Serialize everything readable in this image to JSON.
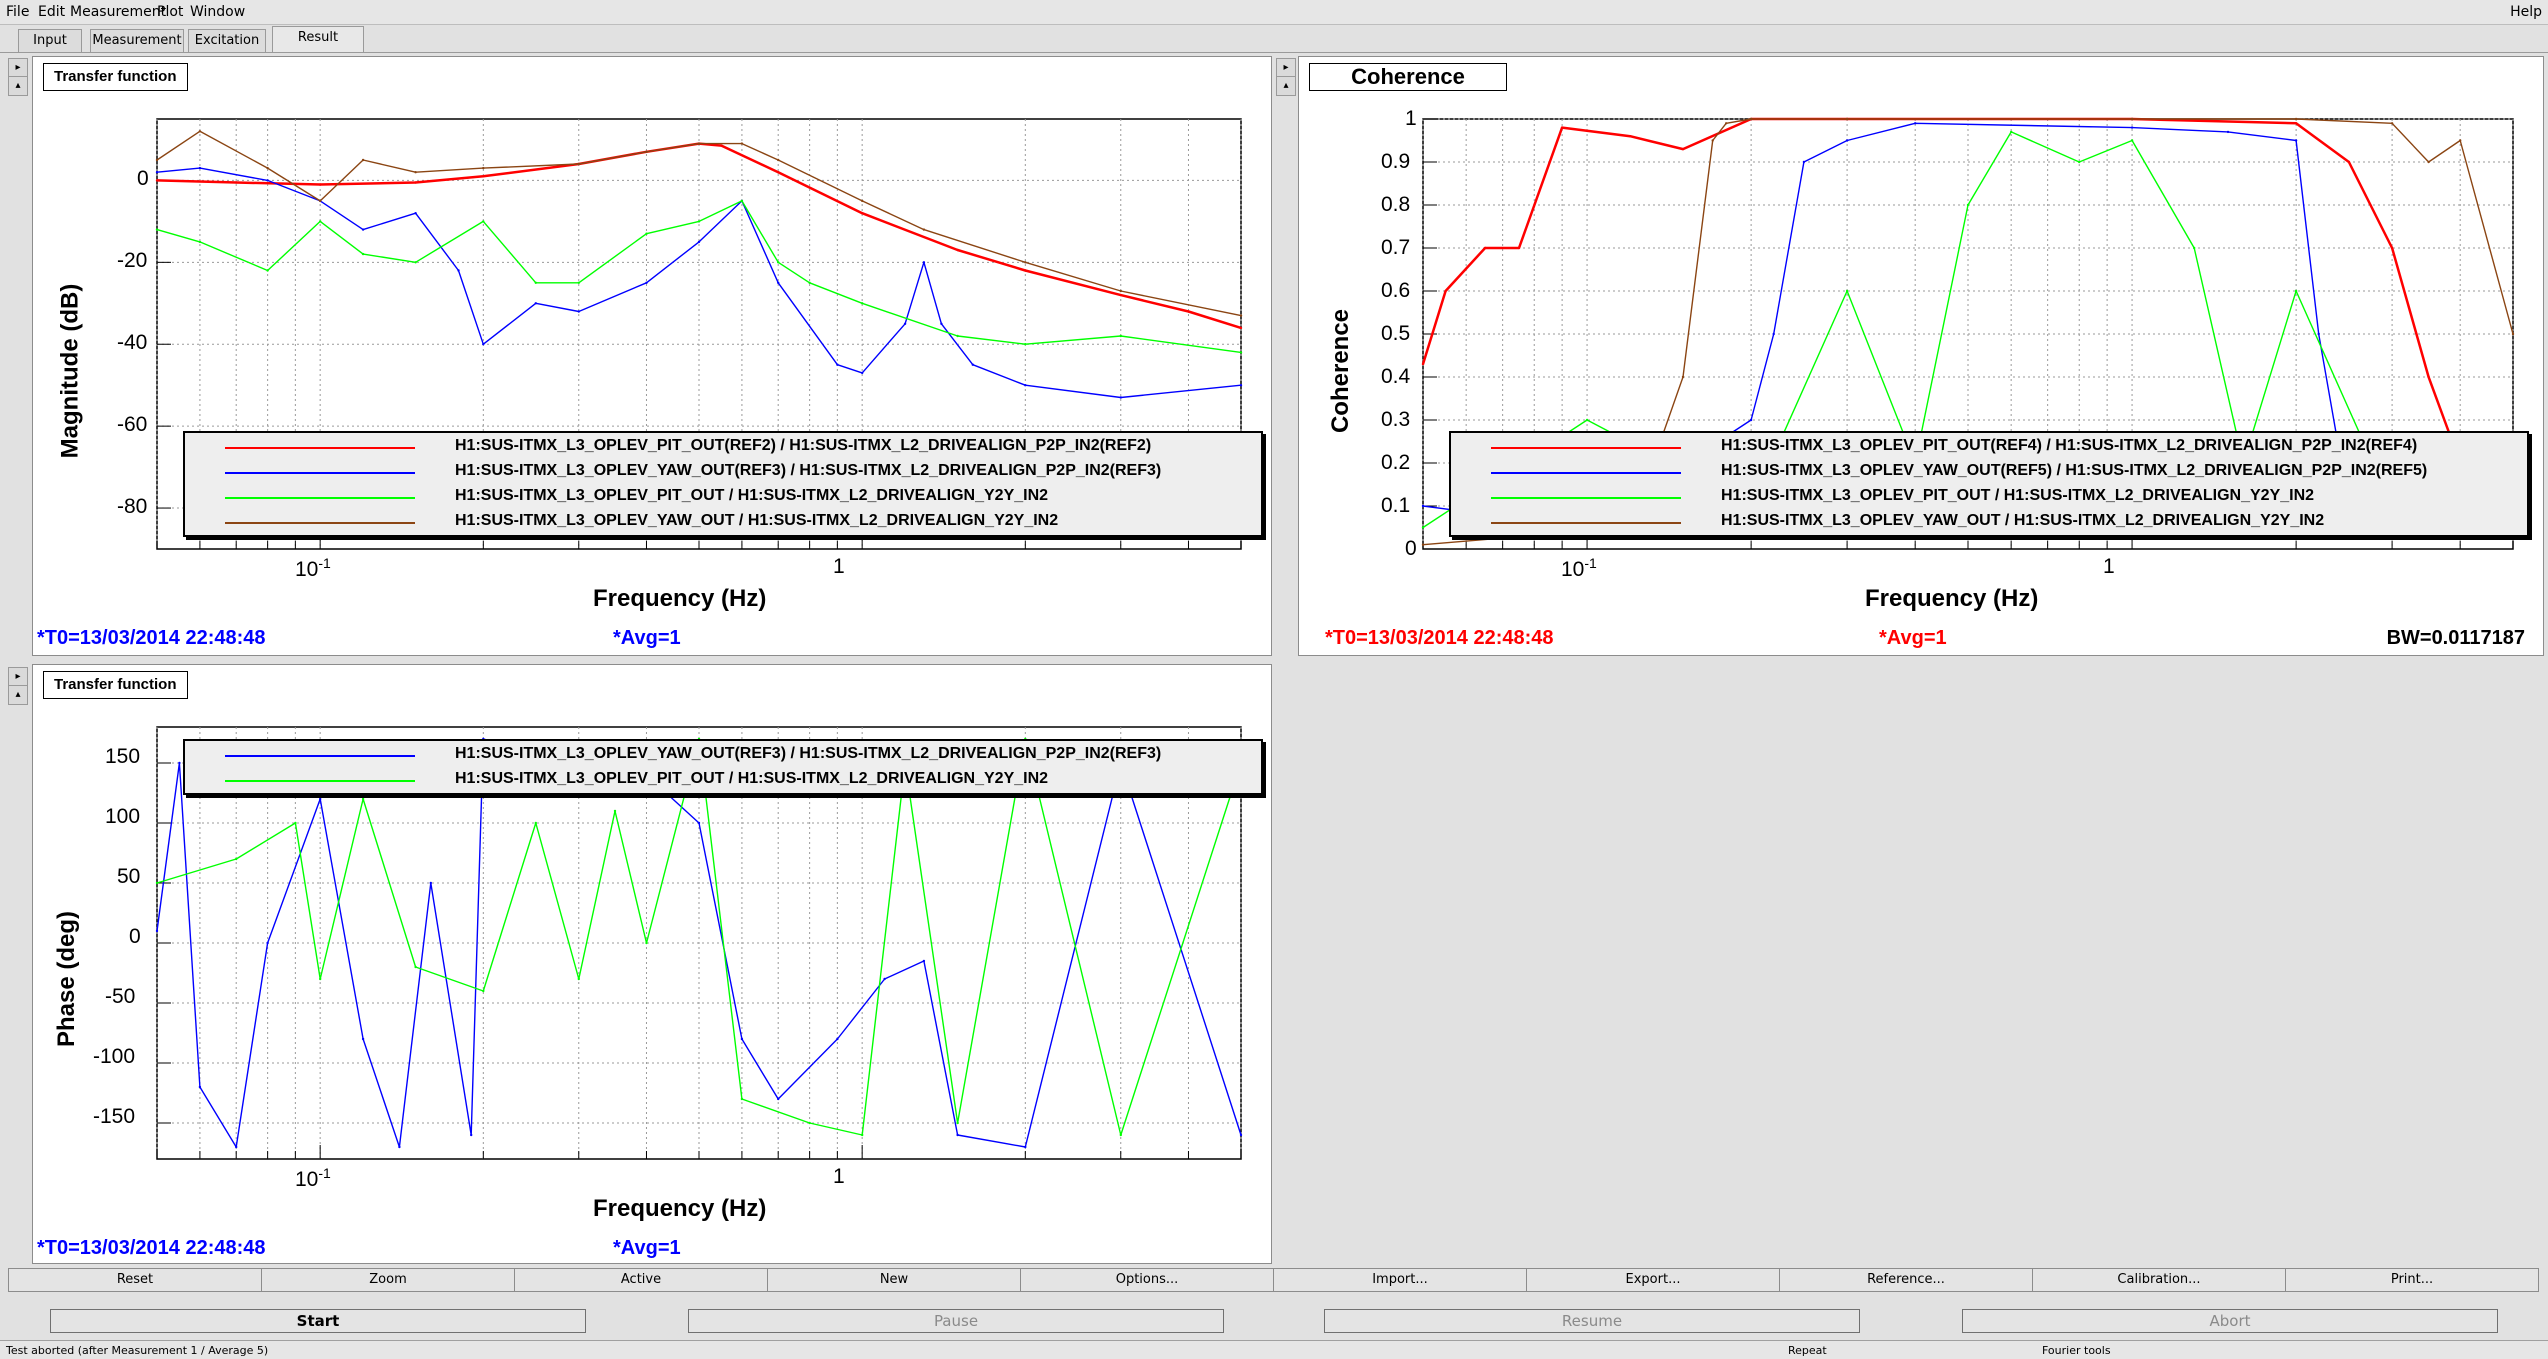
{
  "menu": {
    "items": [
      "File",
      "Edit",
      "Measurement",
      "Plot",
      "Window"
    ],
    "help": "Help"
  },
  "tabs": [
    "Input",
    "Measurement",
    "Excitation",
    "Result"
  ],
  "active_tab": "Result",
  "colors": {
    "red": "#ff0000",
    "blue": "#0000ff",
    "green": "#00ff00",
    "brown": "#8b4513",
    "footer_blue": "#0000ff",
    "footer_red": "#ff0000"
  },
  "panels": {
    "mag": {
      "title": "Transfer function",
      "ylabel": "Magnitude (dB)",
      "xlabel": "Frequency (Hz)",
      "yticks": [
        "0",
        "-20",
        "-40",
        "-60",
        "-80"
      ],
      "xticks": [
        "10",
        "-1",
        "1"
      ],
      "legend": [
        {
          "label": "H1:SUS-ITMX_L3_OPLEV_PIT_OUT(REF2) / H1:SUS-ITMX_L2_DRIVEALIGN_P2P_IN2(REF2)",
          "color": "#ff0000"
        },
        {
          "label": "H1:SUS-ITMX_L3_OPLEV_YAW_OUT(REF3) / H1:SUS-ITMX_L2_DRIVEALIGN_P2P_IN2(REF3)",
          "color": "#0000ff"
        },
        {
          "label": "H1:SUS-ITMX_L3_OPLEV_PIT_OUT / H1:SUS-ITMX_L2_DRIVEALIGN_Y2Y_IN2",
          "color": "#00ff00"
        },
        {
          "label": "H1:SUS-ITMX_L3_OPLEV_YAW_OUT / H1:SUS-ITMX_L2_DRIVEALIGN_Y2Y_IN2",
          "color": "#8b4513"
        }
      ],
      "t0": "*T0=13/03/2014 22:48:48",
      "avg": "*Avg=1"
    },
    "coh": {
      "title": "Coherence",
      "ylabel": "Coherence",
      "xlabel": "Frequency (Hz)",
      "yticks": [
        "1",
        "0.9",
        "0.8",
        "0.7",
        "0.6",
        "0.5",
        "0.4",
        "0.3",
        "0.2",
        "0.1",
        "0"
      ],
      "xticks": [
        "10",
        "-1",
        "1"
      ],
      "legend": [
        {
          "label": "H1:SUS-ITMX_L3_OPLEV_PIT_OUT(REF4) / H1:SUS-ITMX_L2_DRIVEALIGN_P2P_IN2(REF4)",
          "color": "#ff0000"
        },
        {
          "label": "H1:SUS-ITMX_L3_OPLEV_YAW_OUT(REF5) / H1:SUS-ITMX_L2_DRIVEALIGN_P2P_IN2(REF5)",
          "color": "#0000ff"
        },
        {
          "label": "H1:SUS-ITMX_L3_OPLEV_PIT_OUT / H1:SUS-ITMX_L2_DRIVEALIGN_Y2Y_IN2",
          "color": "#00ff00"
        },
        {
          "label": "H1:SUS-ITMX_L3_OPLEV_YAW_OUT / H1:SUS-ITMX_L2_DRIVEALIGN_Y2Y_IN2",
          "color": "#8b4513"
        }
      ],
      "t0": "*T0=13/03/2014 22:48:48",
      "avg": "*Avg=1",
      "bw": "BW=0.0117187"
    },
    "phase": {
      "title": "Transfer function",
      "ylabel": "Phase (deg)",
      "xlabel": "Frequency (Hz)",
      "yticks": [
        "150",
        "100",
        "50",
        "0",
        "-50",
        "-100",
        "-150"
      ],
      "xticks": [
        "10",
        "-1",
        "1"
      ],
      "legend": [
        {
          "label": "H1:SUS-ITMX_L3_OPLEV_YAW_OUT(REF3) / H1:SUS-ITMX_L2_DRIVEALIGN_P2P_IN2(REF3)",
          "color": "#0000ff"
        },
        {
          "label": "H1:SUS-ITMX_L3_OPLEV_PIT_OUT / H1:SUS-ITMX_L2_DRIVEALIGN_Y2Y_IN2",
          "color": "#00ff00"
        }
      ],
      "t0": "*T0=13/03/2014 22:48:48",
      "avg": "*Avg=1"
    }
  },
  "toolbar": [
    "Reset",
    "Zoom",
    "Active",
    "New",
    "Options...",
    "Import...",
    "Export...",
    "Reference...",
    "Calibration...",
    "Print..."
  ],
  "controls": [
    "Start",
    "Pause",
    "Resume",
    "Abort"
  ],
  "status": {
    "message": "Test aborted (after Measurement 1 / Average 5)",
    "repeat": "Repeat",
    "tools": "Fourier tools"
  },
  "chart_data": [
    {
      "type": "line",
      "title": "Transfer function",
      "xlabel": "Frequency (Hz)",
      "ylabel": "Magnitude (dB)",
      "xscale": "log",
      "xlim": [
        0.05,
        5
      ],
      "ylim": [
        -90,
        15
      ],
      "grid": true,
      "legend_position": "bottom",
      "series": [
        {
          "name": "H1:SUS-ITMX_L3_OPLEV_PIT_OUT(REF2) / H1:SUS-ITMX_L2_DRIVEALIGN_P2P_IN2(REF2)",
          "color": "#ff0000",
          "x": [
            0.05,
            0.07,
            0.1,
            0.15,
            0.2,
            0.3,
            0.4,
            0.5,
            0.55,
            0.7,
            1,
            1.5,
            2,
            3,
            4,
            5
          ],
          "y": [
            0,
            -0.5,
            -1,
            -0.5,
            1,
            4,
            7,
            9,
            8.5,
            2,
            -8,
            -17,
            -22,
            -28,
            -32,
            -36
          ]
        },
        {
          "name": "H1:SUS-ITMX_L3_OPLEV_YAW_OUT(REF3) / H1:SUS-ITMX_L2_DRIVEALIGN_P2P_IN2(REF3)",
          "color": "#0000ff",
          "x": [
            0.05,
            0.06,
            0.08,
            0.1,
            0.12,
            0.15,
            0.18,
            0.2,
            0.25,
            0.3,
            0.4,
            0.5,
            0.6,
            0.7,
            0.9,
            1,
            1.2,
            1.3,
            1.4,
            1.6,
            2,
            3,
            5
          ],
          "y": [
            2,
            3,
            0,
            -5,
            -12,
            -8,
            -22,
            -40,
            -30,
            -32,
            -25,
            -15,
            -5,
            -25,
            -45,
            -47,
            -35,
            -20,
            -35,
            -45,
            -50,
            -53,
            -50
          ]
        },
        {
          "name": "H1:SUS-ITMX_L3_OPLEV_PIT_OUT / H1:SUS-ITMX_L2_DRIVEALIGN_Y2Y_IN2",
          "color": "#00ff00",
          "x": [
            0.05,
            0.06,
            0.08,
            0.1,
            0.12,
            0.15,
            0.2,
            0.25,
            0.3,
            0.4,
            0.5,
            0.6,
            0.7,
            0.8,
            1,
            1.5,
            2,
            3,
            5
          ],
          "y": [
            -12,
            -15,
            -22,
            -10,
            -18,
            -20,
            -10,
            -25,
            -25,
            -13,
            -10,
            -5,
            -20,
            -25,
            -30,
            -38,
            -40,
            -38,
            -42
          ]
        },
        {
          "name": "H1:SUS-ITMX_L3_OPLEV_YAW_OUT / H1:SUS-ITMX_L2_DRIVEALIGN_Y2Y_IN2",
          "color": "#8b4513",
          "x": [
            0.05,
            0.06,
            0.08,
            0.1,
            0.12,
            0.15,
            0.2,
            0.3,
            0.4,
            0.5,
            0.6,
            0.7,
            1,
            1.3,
            2,
            3,
            5
          ],
          "y": [
            5,
            12,
            3,
            -5,
            5,
            2,
            3,
            4,
            7,
            9,
            9,
            5,
            -5,
            -12,
            -20,
            -27,
            -33
          ]
        }
      ]
    },
    {
      "type": "line",
      "title": "Coherence",
      "xlabel": "Frequency (Hz)",
      "ylabel": "Coherence",
      "xscale": "log",
      "xlim": [
        0.05,
        5
      ],
      "ylim": [
        0,
        1
      ],
      "grid": true,
      "legend_position": "bottom",
      "series": [
        {
          "name": "H1:SUS-ITMX_L3_OPLEV_PIT_OUT(REF4) / H1:SUS-ITMX_L2_DRIVEALIGN_P2P_IN2(REF4)",
          "color": "#ff0000",
          "x": [
            0.05,
            0.055,
            0.065,
            0.075,
            0.09,
            0.12,
            0.15,
            0.2,
            0.3,
            1,
            2,
            2.5,
            3,
            3.5,
            4,
            5
          ],
          "y": [
            0.43,
            0.6,
            0.7,
            0.7,
            0.98,
            0.96,
            0.93,
            1,
            1,
            1,
            0.99,
            0.9,
            0.7,
            0.4,
            0.2,
            0.1
          ]
        },
        {
          "name": "H1:SUS-ITMX_L3_OPLEV_YAW_OUT(REF5) / H1:SUS-ITMX_L2_DRIVEALIGN_P2P_IN2(REF5)",
          "color": "#0000ff",
          "x": [
            0.05,
            0.1,
            0.2,
            0.22,
            0.25,
            0.3,
            0.4,
            1,
            1.5,
            2,
            2.2,
            2.5,
            3
          ],
          "y": [
            0.1,
            0.05,
            0.3,
            0.5,
            0.9,
            0.95,
            0.99,
            0.98,
            0.97,
            0.95,
            0.5,
            0.1,
            0.05
          ]
        },
        {
          "name": "H1:SUS-ITMX_L3_OPLEV_PIT_OUT / H1:SUS-ITMX_L2_DRIVEALIGN_Y2Y_IN2",
          "color": "#00ff00",
          "x": [
            0.05,
            0.1,
            0.2,
            0.3,
            0.4,
            0.5,
            0.6,
            0.8,
            1,
            1.3,
            1.6,
            2,
            3
          ],
          "y": [
            0.05,
            0.3,
            0.1,
            0.6,
            0.2,
            0.8,
            0.97,
            0.9,
            0.95,
            0.7,
            0.2,
            0.6,
            0.1
          ]
        },
        {
          "name": "H1:SUS-ITMX_L3_OPLEV_YAW_OUT / H1:SUS-ITMX_L2_DRIVEALIGN_Y2Y_IN2",
          "color": "#8b4513",
          "x": [
            0.05,
            0.12,
            0.15,
            0.17,
            0.18,
            0.2,
            0.3,
            1,
            2,
            3,
            3.5,
            4,
            5
          ],
          "y": [
            0.01,
            0.05,
            0.4,
            0.95,
            0.99,
            1,
            1,
            1,
            1,
            0.99,
            0.9,
            0.95,
            0.5
          ]
        }
      ]
    },
    {
      "type": "line",
      "title": "Transfer function",
      "xlabel": "Frequency (Hz)",
      "ylabel": "Phase (deg)",
      "xscale": "log",
      "xlim": [
        0.05,
        5
      ],
      "ylim": [
        -180,
        180
      ],
      "grid": true,
      "legend_position": "top",
      "series": [
        {
          "name": "H1:SUS-ITMX_L3_OPLEV_YAW_OUT(REF3) / H1:SUS-ITMX_L2_DRIVEALIGN_P2P_IN2(REF3)",
          "color": "#0000ff",
          "x": [
            0.05,
            0.055,
            0.06,
            0.07,
            0.08,
            0.1,
            0.12,
            0.14,
            0.16,
            0.19,
            0.2,
            0.3,
            0.4,
            0.5,
            0.6,
            0.7,
            0.9,
            1.1,
            1.3,
            1.5,
            2,
            3,
            5
          ],
          "y": [
            10,
            150,
            -120,
            -170,
            0,
            120,
            -80,
            -170,
            50,
            -160,
            170,
            150,
            140,
            100,
            -80,
            -130,
            -80,
            -30,
            -15,
            -160,
            -170,
            150,
            -160
          ]
        },
        {
          "name": "H1:SUS-ITMX_L3_OPLEV_PIT_OUT / H1:SUS-ITMX_L2_DRIVEALIGN_Y2Y_IN2",
          "color": "#00ff00",
          "x": [
            0.05,
            0.07,
            0.09,
            0.1,
            0.12,
            0.15,
            0.2,
            0.25,
            0.3,
            0.35,
            0.4,
            0.5,
            0.6,
            0.8,
            1,
            1.2,
            1.5,
            2,
            3,
            5
          ],
          "y": [
            50,
            70,
            100,
            -30,
            120,
            -20,
            -40,
            100,
            -30,
            110,
            0,
            170,
            -130,
            -150,
            -160,
            150,
            -150,
            170,
            -160,
            150
          ]
        }
      ]
    }
  ]
}
